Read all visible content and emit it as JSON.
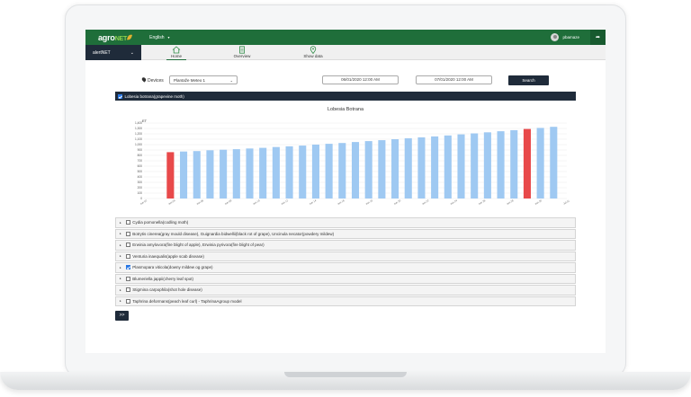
{
  "app": {
    "logo_main": "agro",
    "logo_accent": "NET",
    "language": "English",
    "username": "pbamaze"
  },
  "nav": {
    "product": "alertNET",
    "tabs": [
      {
        "label": "Home",
        "icon": "home-icon"
      },
      {
        "label": "Overview",
        "icon": "document-icon"
      },
      {
        "label": "Show data",
        "icon": "map-pin-icon"
      }
    ]
  },
  "filters": {
    "devices_label": "Devices",
    "device_value": "Plantaže Meteo 1",
    "date_from": "06/01/2020 12:00 AM",
    "date_to": "07/01/2020 12:00 AM",
    "search_label": "Search"
  },
  "section": {
    "label": "Lobesia botrana(grapevine moth)"
  },
  "colors": {
    "bar_normal": "#9fc9f2",
    "bar_alert": "#e8494a",
    "dark": "#1f2b3a",
    "green": "#1f6e3a"
  },
  "chart_data": {
    "type": "bar",
    "title": "Lobesia Botrana",
    "ylabel": "ET",
    "ylim": [
      0,
      1400
    ],
    "yticks": [
      0,
      100,
      200,
      300,
      400,
      500,
      600,
      700,
      800,
      900,
      1000,
      1100,
      1200,
      1300,
      1400
    ],
    "ytick_labels": [
      "0",
      "100",
      "200",
      "300",
      "400",
      "500",
      "600",
      "700",
      "800",
      "900",
      "1,000",
      "1,100",
      "1,200",
      "1,300",
      "1,400"
    ],
    "xtick_labels": [
      "Jun 02",
      "Jun 04",
      "Jun 06",
      "Jun 08",
      "Jun 10",
      "Jun 12",
      "Jun 14",
      "Jun 16",
      "Jun 18",
      "Jun 20",
      "Jun 22",
      "Jun 24",
      "Jun 26",
      "Jun 28",
      "Jun 30",
      "Jul 01"
    ],
    "values": [
      860,
      872,
      880,
      895,
      905,
      915,
      928,
      940,
      955,
      968,
      982,
      1000,
      1015,
      1030,
      1048,
      1065,
      1082,
      1100,
      1118,
      1135,
      1152,
      1170,
      1190,
      1208,
      1228,
      1248,
      1268,
      1290,
      1310,
      1330
    ],
    "alert_indices": [
      0,
      27
    ]
  },
  "diseases": [
    {
      "label": "Cydia pomonella(codling moth)",
      "checked": false
    },
    {
      "label": "Botrytis cinerea(gray mould disease), Guignardia bidwellii(black rot of grape), Uncinula necator(powdery mildew)",
      "checked": false
    },
    {
      "label": "Erwinia amylovora(fire blight of apple), Erwinia pyrivora(fire blight of pear)",
      "checked": false
    },
    {
      "label": "Venturia inaequalis(apple scab disease)",
      "checked": false
    },
    {
      "label": "Plasmopara viticola(downy mildew og grape)",
      "checked": true
    },
    {
      "label": "Blumeriella jappii(cherry leaf spot)",
      "checked": false
    },
    {
      "label": "Stigmina carpophila(shot hole disease)",
      "checked": false
    },
    {
      "label": "Taphrina deformans(peach leaf curl) - TaphrinaAgroup model",
      "checked": false
    }
  ],
  "more_label": ">>"
}
